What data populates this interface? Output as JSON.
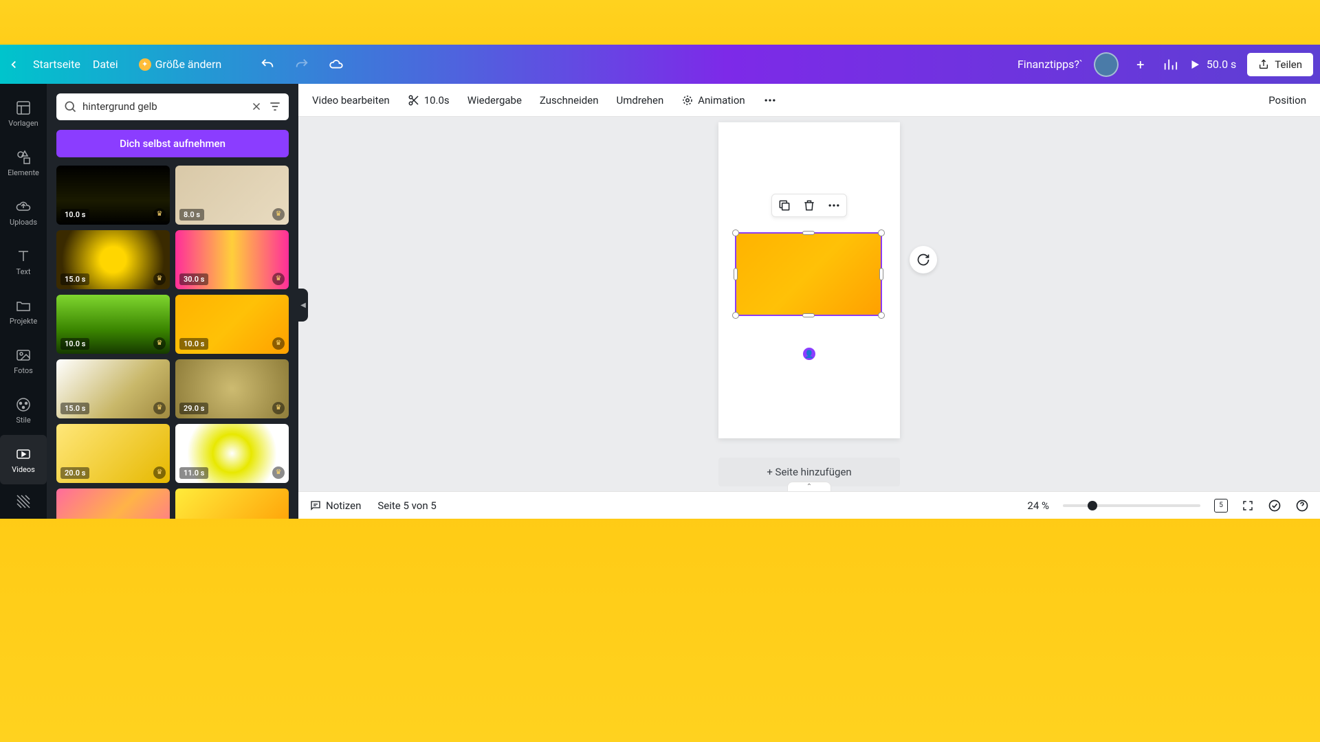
{
  "topbar": {
    "home": "Startseite",
    "file": "Datei",
    "resize": "Größe ändern",
    "project_title": "Finanztipps?`",
    "duration": "50.0 s",
    "share": "Teilen"
  },
  "rail": [
    {
      "icon": "templates",
      "label": "Vorlagen"
    },
    {
      "icon": "elements",
      "label": "Elemente"
    },
    {
      "icon": "uploads",
      "label": "Uploads"
    },
    {
      "icon": "text",
      "label": "Text"
    },
    {
      "icon": "projects",
      "label": "Projekte"
    },
    {
      "icon": "photos",
      "label": "Fotos"
    },
    {
      "icon": "styles",
      "label": "Stile"
    },
    {
      "icon": "videos",
      "label": "Videos"
    }
  ],
  "search": {
    "value": "hintergrund gelb",
    "placeholder": "hintergrund gelb"
  },
  "record_button": "Dich selbst aufnehmen",
  "thumbs": [
    {
      "dur": "10.0 s",
      "bg": "linear-gradient(180deg,#000,#1a1a00 60%,#000)",
      "overlay": "wave-gold"
    },
    {
      "dur": "8.0 s",
      "bg": "linear-gradient(135deg,#d9c9a8,#e8dbc0)",
      "overlay": "sparkle"
    },
    {
      "dur": "15.0 s",
      "bg": "radial-gradient(circle,#ffd600 20%,#3a2a00 80%)",
      "overlay": "star"
    },
    {
      "dur": "30.0 s",
      "bg": "linear-gradient(90deg,#ff2e9a,#ffcf3a,#ff2e9a)",
      "overlay": "stripes"
    },
    {
      "dur": "10.0 s",
      "bg": "linear-gradient(180deg,#7fd62f,#3a8500 60%,#163a00)",
      "overlay": "particles"
    },
    {
      "dur": "10.0 s",
      "bg": "linear-gradient(135deg,#ffb300,#ffc107,#ffa000)",
      "overlay": "plain"
    },
    {
      "dur": "15.0 s",
      "bg": "linear-gradient(135deg,#fff,#c9b86a 60%,#a08a40)",
      "overlay": "splatter"
    },
    {
      "dur": "29.0 s",
      "bg": "radial-gradient(circle,#cdbb71,#8f7d3a)",
      "overlay": "bokeh"
    },
    {
      "dur": "20.0 s",
      "bg": "linear-gradient(135deg,#ffe77a,#e6b800)",
      "overlay": "ink"
    },
    {
      "dur": "11.0 s",
      "bg": "radial-gradient(circle,#fff,#e8e800 30%,#fff 70%)",
      "overlay": "shatter"
    },
    {
      "dur": "",
      "bg": "linear-gradient(135deg,#ff6b9d,#ffb347,#ff6b9d)",
      "overlay": ""
    },
    {
      "dur": "",
      "bg": "linear-gradient(135deg,#ffeb3b,#ff9800)",
      "overlay": ""
    }
  ],
  "context_bar": {
    "edit_video": "Video bearbeiten",
    "duration": "10.0s",
    "playback": "Wiedergabe",
    "crop": "Zuschneiden",
    "flip": "Umdrehen",
    "animation": "Animation",
    "position": "Position"
  },
  "add_page": "+ Seite hinzufügen",
  "bottombar": {
    "notes": "Notizen",
    "page_indicator": "Seite 5 von 5",
    "zoom": "24 %",
    "page_badge": "5"
  }
}
